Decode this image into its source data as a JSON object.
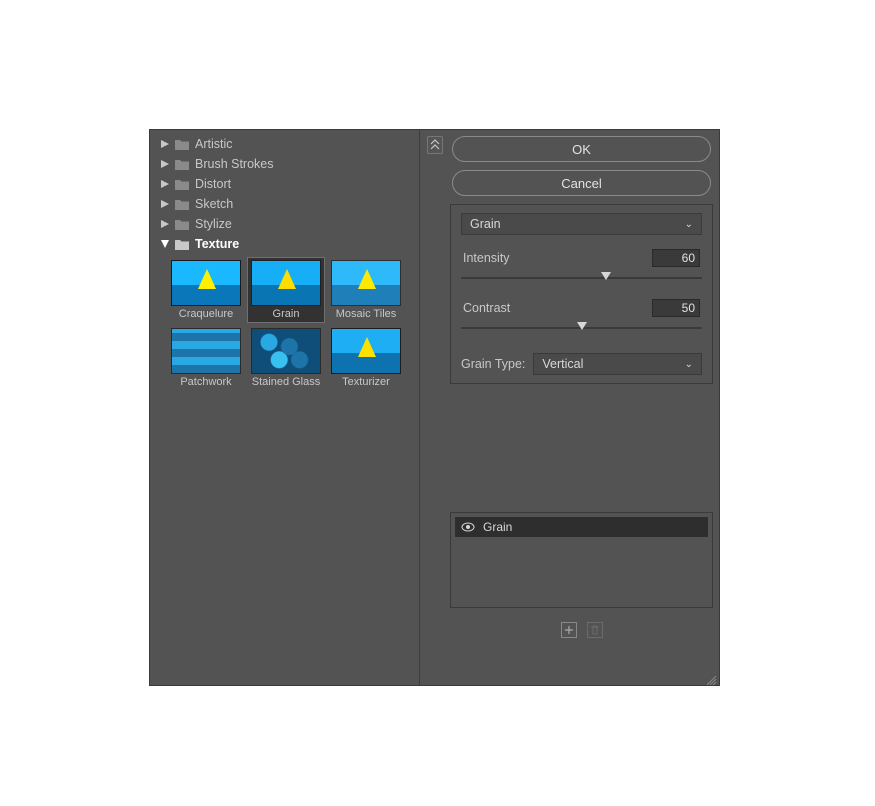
{
  "categories": [
    {
      "label": "Artistic",
      "expanded": false
    },
    {
      "label": "Brush Strokes",
      "expanded": false
    },
    {
      "label": "Distort",
      "expanded": false
    },
    {
      "label": "Sketch",
      "expanded": false
    },
    {
      "label": "Stylize",
      "expanded": false
    },
    {
      "label": "Texture",
      "expanded": true
    }
  ],
  "texture_thumbs": {
    "craquelure": "Craquelure",
    "grain": "Grain",
    "mosaic": "Mosaic Tiles",
    "patchwork": "Patchwork",
    "stained_glass": "Stained Glass",
    "texturizer": "Texturizer"
  },
  "buttons": {
    "ok": "OK",
    "cancel": "Cancel"
  },
  "filter_dropdown": {
    "selected": "Grain"
  },
  "params": {
    "intensity": {
      "label": "Intensity",
      "value": "60",
      "percent": 60
    },
    "contrast": {
      "label": "Contrast",
      "value": "50",
      "percent": 50
    },
    "grain_type": {
      "label": "Grain Type:",
      "selected": "Vertical"
    }
  },
  "layers": {
    "row1": "Grain"
  }
}
